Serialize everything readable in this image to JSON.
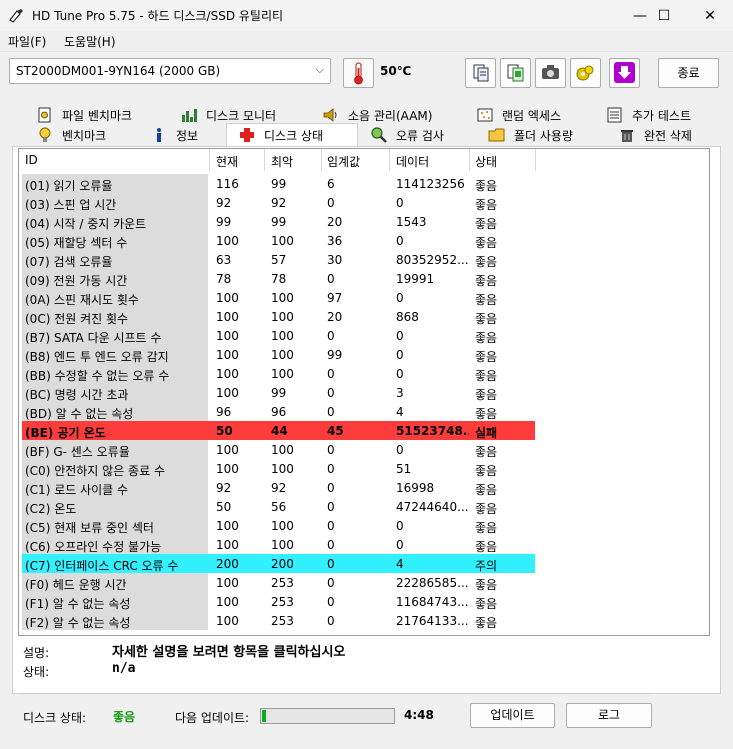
{
  "window": {
    "title": "HD Tune Pro 5.75 - 하드 디스크/SSD 유틸리티",
    "controls": {
      "minimize": "—",
      "maximize": "☐",
      "close": "✕"
    }
  },
  "menu": {
    "file": "파일(F)",
    "help": "도움말(H)"
  },
  "toolbar": {
    "drive": "ST2000DM001-9YN164 (2000 GB)",
    "temperature": "50℃",
    "buttons": [
      "copy-text-icon",
      "copy-info-icon",
      "screenshot-icon",
      "options-icon",
      "save-icon"
    ],
    "exit": "종료"
  },
  "tabs": {
    "row1": [
      {
        "label": "파일 벤치마크",
        "icon": "file-benchmark-icon"
      },
      {
        "label": "디스크 모니터",
        "icon": "disk-monitor-icon"
      },
      {
        "label": "소음 관리(AAM)",
        "icon": "speaker-icon"
      },
      {
        "label": "랜덤 엑세스",
        "icon": "random-access-icon"
      },
      {
        "label": "추가 테스트",
        "icon": "extra-tests-icon"
      }
    ],
    "row2": [
      {
        "label": "벤치마크",
        "icon": "lightbulb-icon"
      },
      {
        "label": "정보",
        "icon": "info-icon"
      },
      {
        "label": "디스크 상태",
        "icon": "health-cross-icon",
        "active": true
      },
      {
        "label": "오류 검사",
        "icon": "magnifier-icon"
      },
      {
        "label": "폴더 사용량",
        "icon": "folder-icon"
      },
      {
        "label": "완전 삭제",
        "icon": "trash-icon"
      }
    ]
  },
  "table": {
    "headers": [
      "ID",
      "현재",
      "최악",
      "임계값",
      "데이터",
      "상태"
    ],
    "rows": [
      [
        "(01) 읽기 오류율",
        "116",
        "99",
        "6",
        "114123256",
        "좋음"
      ],
      [
        "(03) 스핀 업 시간",
        "92",
        "92",
        "0",
        "0",
        "좋음"
      ],
      [
        "(04) 시작 / 중지 카운트",
        "99",
        "99",
        "20",
        "1543",
        "좋음"
      ],
      [
        "(05) 재할당 섹터 수",
        "100",
        "100",
        "36",
        "0",
        "좋음"
      ],
      [
        "(07) 검색 오류율",
        "63",
        "57",
        "30",
        "80352952...",
        "좋음"
      ],
      [
        "(09) 전원 가동 시간",
        "78",
        "78",
        "0",
        "19991",
        "좋음"
      ],
      [
        "(0A) 스핀 재시도 횟수",
        "100",
        "100",
        "97",
        "0",
        "좋음"
      ],
      [
        "(0C) 전원 켜진 횟수",
        "100",
        "100",
        "20",
        "868",
        "좋음"
      ],
      [
        "(B7) SATA 다운 시프트 수",
        "100",
        "100",
        "0",
        "0",
        "좋음"
      ],
      [
        "(B8) 엔드 투 엔드 오류 감지",
        "100",
        "100",
        "99",
        "0",
        "좋음"
      ],
      [
        "(BB) 수정할 수 없는 오류 수",
        "100",
        "100",
        "0",
        "0",
        "좋음"
      ],
      [
        "(BC) 명령 시간 초과",
        "100",
        "99",
        "0",
        "3",
        "좋음"
      ],
      [
        "(BD) 알 수 없는 속성",
        "96",
        "96",
        "0",
        "4",
        "좋음"
      ],
      [
        "(BE) 공기 온도",
        "50",
        "44",
        "45",
        "51523748...",
        "실패"
      ],
      [
        "(BF) G- 센스 오류율",
        "100",
        "100",
        "0",
        "0",
        "좋음"
      ],
      [
        "(C0) 안전하지 않은 종료 수",
        "100",
        "100",
        "0",
        "51",
        "좋음"
      ],
      [
        "(C1) 로드 사이클 수",
        "92",
        "92",
        "0",
        "16998",
        "좋음"
      ],
      [
        "(C2) 온도",
        "50",
        "56",
        "0",
        "47244640...",
        "좋음"
      ],
      [
        "(C5) 현재 보류 중인 섹터",
        "100",
        "100",
        "0",
        "0",
        "좋음"
      ],
      [
        "(C6) 오프라인 수정 불가능",
        "100",
        "100",
        "0",
        "0",
        "좋음"
      ],
      [
        "(C7) 인터페이스 CRC 오류 수",
        "200",
        "200",
        "0",
        "4",
        "주의"
      ],
      [
        "(F0) 헤드 운행 시간",
        "100",
        "253",
        "0",
        "22286585...",
        "좋음"
      ],
      [
        "(F1) 알 수 없는 속성",
        "100",
        "253",
        "0",
        "11684743...",
        "좋음"
      ],
      [
        "(F2) 알 수 없는 속성",
        "100",
        "253",
        "0",
        "21764133...",
        "좋음"
      ]
    ],
    "highlight_colors": {
      "fail": "#ff3c3c",
      "caution": "#33f0ff"
    }
  },
  "details": {
    "description_label": "설명:",
    "description": "자세한 설명을 보려면 항목을 클릭하십시오",
    "status_label": "상태:",
    "status": "n/a"
  },
  "footer": {
    "disk_status_label": "디스크 상태:",
    "disk_status": "좋음",
    "disk_status_color": "#1b9a1b",
    "next_update_label": "다음 업데이트:",
    "next_update_progress": 0.03,
    "countdown": "4:48",
    "update_button": "업데이트",
    "log_button": "로그"
  }
}
